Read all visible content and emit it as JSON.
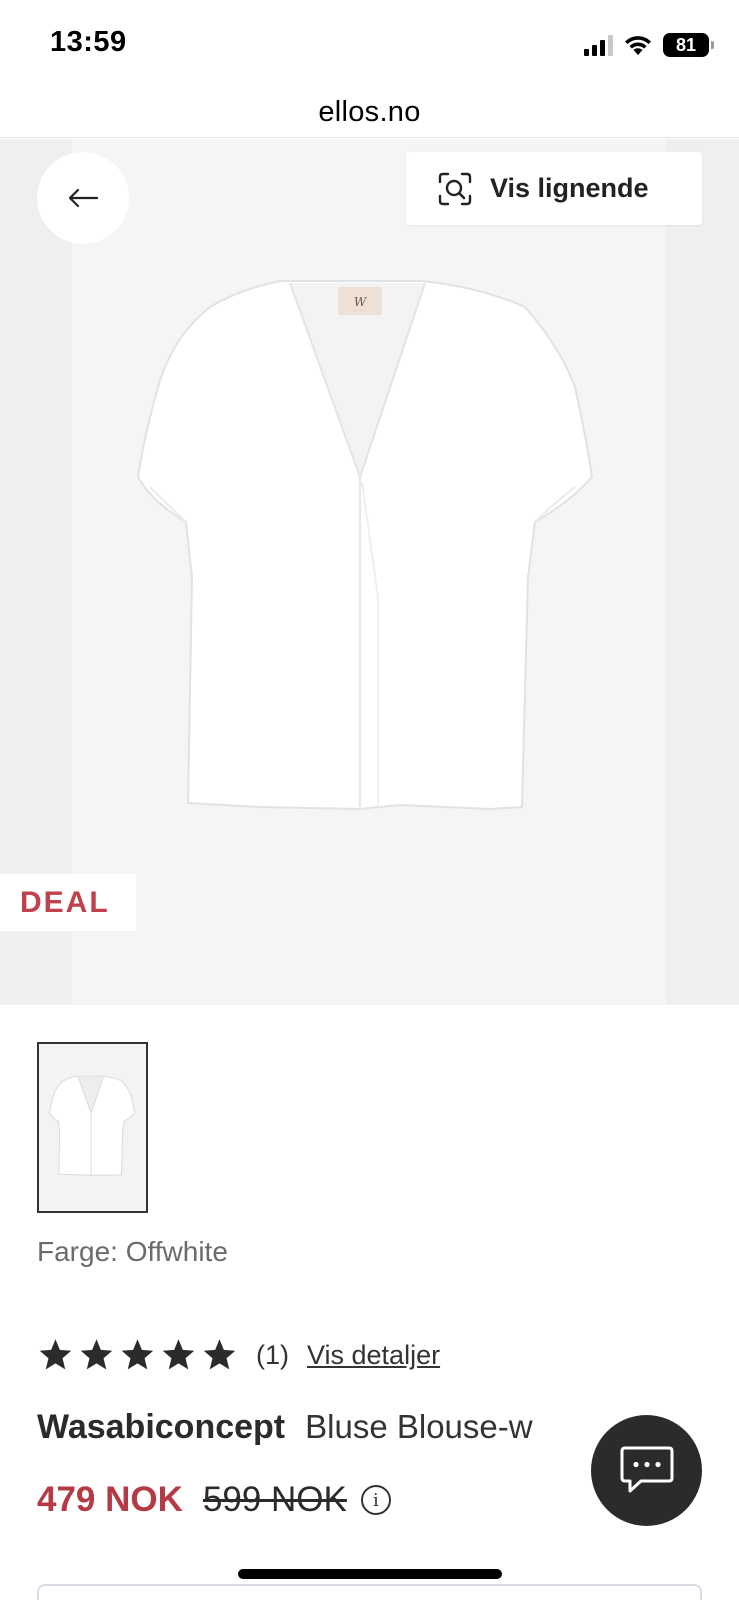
{
  "status_bar": {
    "time": "13:59",
    "battery": "81",
    "icons": [
      "signal-icon",
      "wifi-icon",
      "battery-icon"
    ]
  },
  "browser": {
    "url": "ellos.no"
  },
  "product_image": {
    "back_icon": "arrow-left-icon",
    "similar_button_label": "Vis lignende",
    "similar_icon": "visual-search-icon",
    "badge": "DEAL",
    "badge_color": "#c0404b"
  },
  "color_label": "Farge: Offwhite",
  "rating": {
    "stars": 5,
    "max_stars": 5,
    "count": "(1)",
    "details_link": "Vis detaljer"
  },
  "product": {
    "brand": "Wasabiconcept",
    "name": "Bluse Blouse-w"
  },
  "price": {
    "sale": "479 NOK",
    "original": "599 NOK",
    "sale_color": "#b43a45",
    "info_icon": "info-icon"
  },
  "chat": {
    "icon": "chat-bubble-icon"
  }
}
